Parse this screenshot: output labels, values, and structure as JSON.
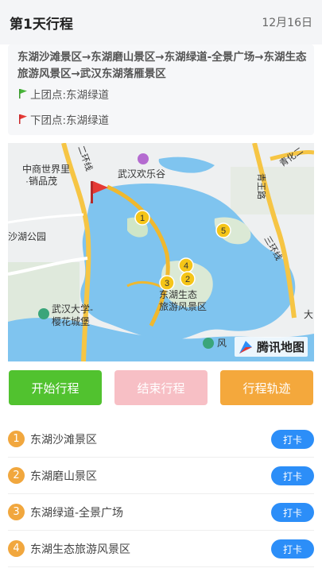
{
  "header": {
    "title": "第1天行程",
    "date": "12月16日"
  },
  "route": {
    "text": "东湖沙滩景区→东湖磨山景区→东湖绿道-全景广场→东湖生态旅游风景区→武汉东湖落雁景区",
    "pickup": "上团点:东湖绿道",
    "dropoff": "下团点:东湖绿道"
  },
  "map": {
    "labels": {
      "zhongshang": "中商世界里",
      "yinpinmao": "·销品茂",
      "huanxiangu": "武汉欢乐谷",
      "qingwang": "青王路",
      "qinghuaer": "青化二",
      "shaohugongyuan": "沙湖公园",
      "sanhuanxian": "三环线",
      "erhuanxian": "二环线",
      "whu": "武汉大学-",
      "yinghua": "樱花城堡",
      "donghushengtai": "东湖生态",
      "lvyoufengjing": "旅游风景区",
      "feng": "风",
      "da": "大"
    },
    "markers": [
      "1",
      "2",
      "3",
      "4",
      "5"
    ],
    "logo": "腾讯地图"
  },
  "buttons": {
    "start": "开始行程",
    "end": "结束行程",
    "track": "行程轨迹"
  },
  "list": [
    {
      "num": "1",
      "name": "东湖沙滩景区",
      "action": "打卡"
    },
    {
      "num": "2",
      "name": "东湖磨山景区",
      "action": "打卡"
    },
    {
      "num": "3",
      "name": "东湖绿道-全景广场",
      "action": "打卡"
    },
    {
      "num": "4",
      "name": "东湖生态旅游风景区",
      "action": "打卡"
    }
  ],
  "colors": {
    "start": "#51c22f",
    "end": "#f7bfc5",
    "track": "#f4a83c",
    "checkin": "#2c8ef8",
    "badge": "#f1a73e",
    "lake": "#7fc4ef"
  }
}
